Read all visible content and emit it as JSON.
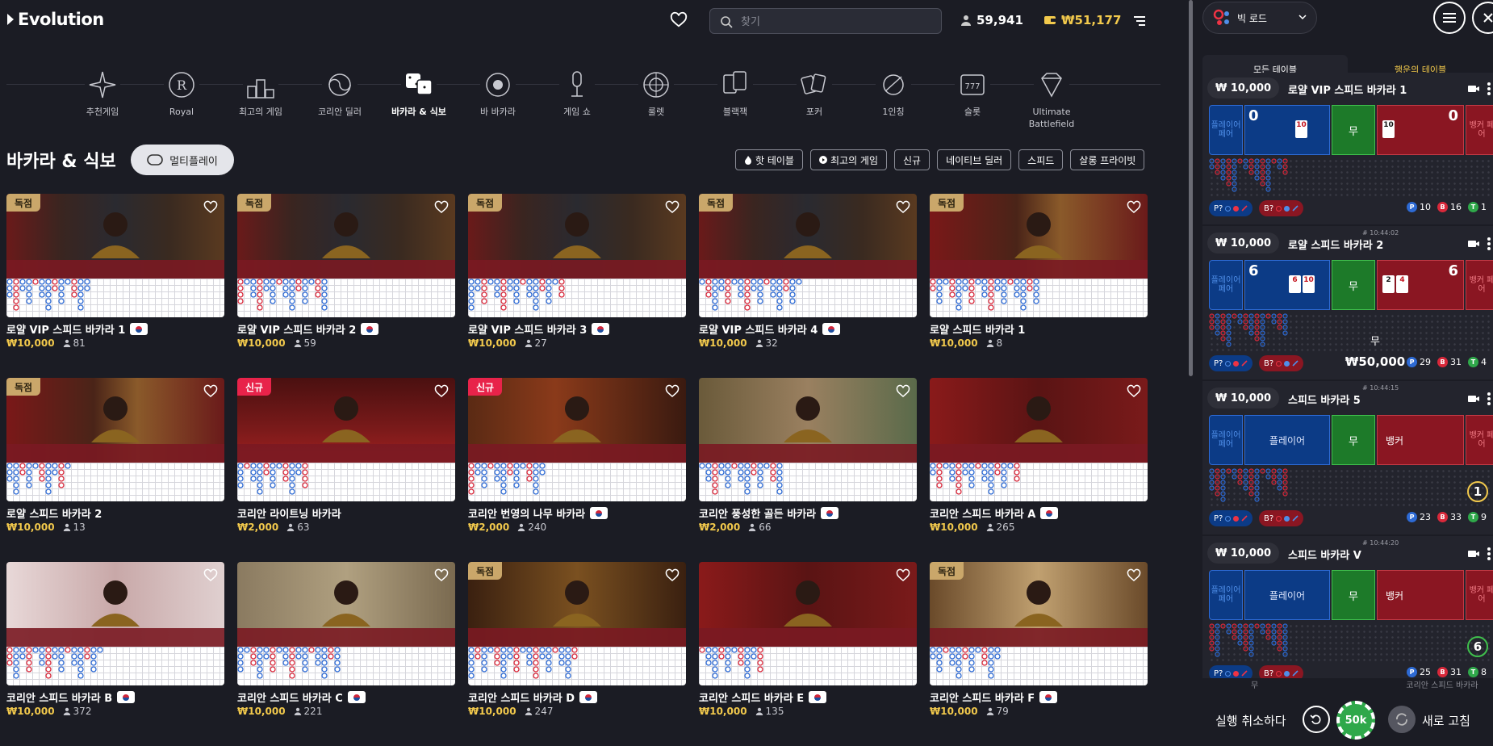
{
  "header": {
    "logo_text": "Evolution",
    "search_placeholder": "찾기",
    "players_count": "59,941",
    "balance": "₩51,177"
  },
  "categories": [
    {
      "label": "추천게임",
      "icon": "sparkle-icon"
    },
    {
      "label": "Royal",
      "icon": "royal-crest-icon"
    },
    {
      "label": "최고의 게임",
      "icon": "podium-icon"
    },
    {
      "label": "코리안 딜러",
      "icon": "korean-taeguk-icon"
    },
    {
      "label": "바카라 & 식보",
      "icon": "dice-icon",
      "active": true
    },
    {
      "label": "바 바카라",
      "icon": "speed-baccarat-icon"
    },
    {
      "label": "게임 쇼",
      "icon": "microphone-icon"
    },
    {
      "label": "룰렛",
      "icon": "roulette-icon"
    },
    {
      "label": "블랙잭",
      "icon": "blackjack-cards-icon"
    },
    {
      "label": "포커",
      "icon": "poker-cards-icon"
    },
    {
      "label": "1인칭",
      "icon": "first-person-icon"
    },
    {
      "label": "슬롯",
      "icon": "slot-machine-icon"
    },
    {
      "label": "Ultimate Battlefield",
      "icon": "diamond-icon"
    }
  ],
  "section": {
    "title": "바카라 & 식보",
    "multiplay_label": "멀티플레이",
    "filters": [
      "핫 테이블",
      "최고의 게임",
      "신규",
      "네이티브 딜러",
      "스피드",
      "살롱 프라이빗"
    ]
  },
  "tables": [
    {
      "name": "로얄 VIP 스피드 바카라 1",
      "bet": "₩10,000",
      "players": "81",
      "badge": "독점",
      "flag": true,
      "scene": "royal"
    },
    {
      "name": "로얄 VIP 스피드 바카라 2",
      "bet": "₩10,000",
      "players": "59",
      "badge": "독점",
      "flag": true,
      "scene": "royal"
    },
    {
      "name": "로얄 VIP 스피드 바카라 3",
      "bet": "₩10,000",
      "players": "27",
      "badge": "독점",
      "flag": true,
      "scene": "royal"
    },
    {
      "name": "로얄 VIP 스피드 바카라 4",
      "bet": "₩10,000",
      "players": "32",
      "badge": "독점",
      "flag": true,
      "scene": "royal"
    },
    {
      "name": "로얄 스피드 바카라 1",
      "bet": "₩10,000",
      "players": "8",
      "badge": "독점",
      "flag": false,
      "scene": "royal-red"
    },
    {
      "name": "로얄 스피드 바카라 2",
      "bet": "₩10,000",
      "players": "13",
      "badge": "독점",
      "flag": false,
      "scene": "royal-red"
    },
    {
      "name": "코리안 라이트닝 바카라",
      "bet": "₩2,000",
      "players": "63",
      "badge": "신규",
      "flag": false,
      "scene": "lightning"
    },
    {
      "name": "코리안 번영의 나무 바카라",
      "bet": "₩2,000",
      "players": "240",
      "badge": "신규",
      "flag": true,
      "scene": "tree"
    },
    {
      "name": "코리안 풍성한 골든 바카라",
      "bet": "₩2,000",
      "players": "66",
      "badge": "",
      "flag": true,
      "scene": "golden"
    },
    {
      "name": "코리안 스피드 바카라 A",
      "bet": "₩10,000",
      "players": "265",
      "badge": "",
      "flag": true,
      "scene": "red"
    },
    {
      "name": "코리안 스피드 바카라 B",
      "bet": "₩10,000",
      "players": "372",
      "badge": "",
      "flag": true,
      "scene": "blossom"
    },
    {
      "name": "코리안 스피드 바카라 C",
      "bet": "₩10,000",
      "players": "221",
      "badge": "",
      "flag": true,
      "scene": "classic"
    },
    {
      "name": "코리안 스피드 바카라 D",
      "bet": "₩10,000",
      "players": "247",
      "badge": "독점",
      "flag": true,
      "scene": "dark"
    },
    {
      "name": "코리안 스피드 바카라 E",
      "bet": "₩10,000",
      "players": "135",
      "badge": "",
      "flag": true,
      "scene": "red"
    },
    {
      "name": "코리안 스피드 바카라 F",
      "bet": "₩10,000",
      "players": "79",
      "badge": "독점",
      "flag": true,
      "scene": "moon"
    }
  ],
  "panel": {
    "road_select_label": "빅 로드",
    "tab_all": "모든 테이블",
    "tab_fav": "행운의 테이블",
    "player_pair": "플레이어 페어",
    "tie": "무",
    "banker_pair": "뱅커 페어",
    "pred_p": "P?",
    "pred_b": "B?",
    "undo_label": "실행 취소하다",
    "chip_value": "50k",
    "refresh_label": "새로 고침",
    "peek_text": "코리안 스피드 바카라",
    "peek_tie": "무",
    "tables": [
      {
        "bet": "₩ 10,000",
        "name": "로얄 VIP 스피드 바카라 1",
        "time": "",
        "player_score": "0",
        "banker_score": "0",
        "player_label": "",
        "banker_label": "",
        "p_cards": [
          "10"
        ],
        "b_cards": [
          "10"
        ],
        "stat_p": "10",
        "stat_b": "16",
        "stat_t": "1"
      },
      {
        "bet": "₩ 10,000",
        "name": "로얄 스피드 바카라 2",
        "time": "# 10:44:02",
        "player_score": "6",
        "banker_score": "6",
        "player_label": "",
        "banker_label": "",
        "p_cards": [
          "6",
          "10"
        ],
        "b_cards": [
          "2",
          "4"
        ],
        "stat_p": "29",
        "stat_b": "31",
        "stat_t": "4",
        "win_result": "무",
        "win_amount": "₩50,000"
      },
      {
        "bet": "₩ 10,000",
        "name": "스피드 바카라 5",
        "time": "# 10:44:15",
        "player_score": "",
        "banker_score": "",
        "player_label": "플레이어",
        "banker_label": "뱅커",
        "p_cards": [],
        "b_cards": [],
        "stat_p": "23",
        "stat_b": "33",
        "stat_t": "9",
        "countdown": "1"
      },
      {
        "bet": "₩ 10,000",
        "name": "스피드 바카라 V",
        "time": "# 10:44:20",
        "player_score": "",
        "banker_score": "",
        "player_label": "플레이어",
        "banker_label": "뱅커",
        "p_cards": [],
        "b_cards": [],
        "stat_p": "25",
        "stat_b": "31",
        "stat_t": "8",
        "countdown": "6"
      }
    ]
  },
  "colors": {
    "accent_gold": "#f2c94c",
    "player_blue": "#0c3b86",
    "banker_red": "#8a1622",
    "tie_green": "#1d7a29",
    "badge_exclusive": "#caa76a",
    "badge_new": "#e8234a"
  }
}
